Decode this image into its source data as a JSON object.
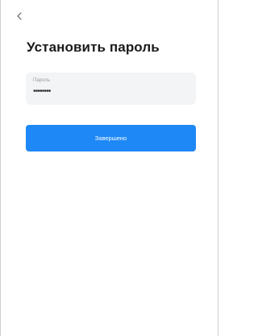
{
  "header": {
    "back_icon": "chevron-left-icon"
  },
  "page": {
    "title": "Установить пароль"
  },
  "password_field": {
    "label": "Пароль",
    "value": "••••••••"
  },
  "finish_button": {
    "label": "Завершено"
  },
  "colors": {
    "accent": "#1e88f6",
    "field_background": "#f3f4f6",
    "title_text": "#1a1a1a",
    "label_text": "#9a9a9a"
  }
}
